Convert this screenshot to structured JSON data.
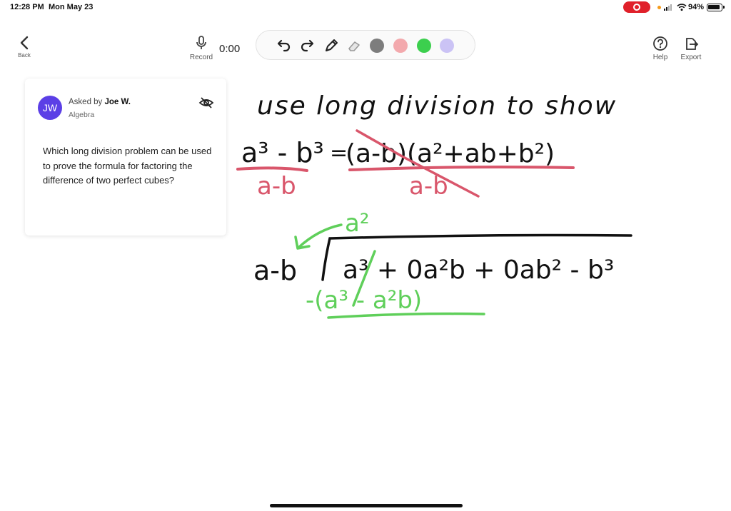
{
  "status_bar": {
    "time": "12:28 PM",
    "date": "Mon May 23",
    "battery_percent": "94%",
    "battery_level": 0.94,
    "icons": [
      "record-indicator-icon",
      "signal-icon",
      "wifi-icon",
      "battery-icon"
    ]
  },
  "toolbar": {
    "back_label": "Back",
    "record_label": "Record",
    "timer": "0:00",
    "help_label": "Help",
    "export_label": "Export",
    "tools": [
      "undo-icon",
      "redo-icon",
      "pen-icon",
      "eraser-icon"
    ],
    "colors": [
      "#7d7d7d",
      "#f3a9ad",
      "#3ccf4e",
      "#cbc3f5"
    ]
  },
  "question_card": {
    "avatar_initials": "JW",
    "asked_prefix": "Asked by",
    "asker_name": "Joe W.",
    "subject": "Algebra",
    "question_text": "Which long division problem can be used to prove the formula for factoring the difference of two perfect cubes?"
  },
  "whiteboard": {
    "ink_colors": {
      "black": "#111111",
      "red": "#d9566b",
      "green": "#5fcf5a"
    },
    "strokes": {
      "line1": "use long division to show",
      "identity_lhs": "a³ - b³",
      "equals": "=",
      "identity_rhs": "(a-b)(a²+ab+b²)",
      "denominator_left": "a-b",
      "denominator_right": "a-b",
      "quotient_term": "a²",
      "divisor": "a-b",
      "dividend": "a³ + 0a²b + 0ab² - b³",
      "subtraction": "-(a³ - a²b)"
    }
  }
}
